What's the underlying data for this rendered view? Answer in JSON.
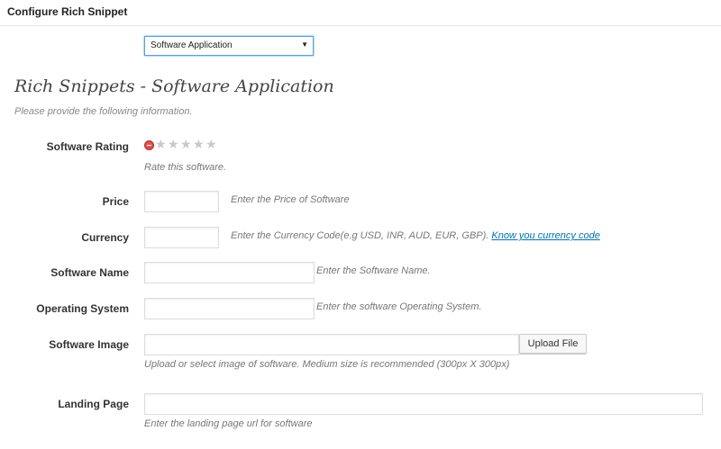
{
  "header": {
    "title": "Configure Rich Snippet"
  },
  "type_select": {
    "value": "Software Application"
  },
  "section": {
    "title": "Rich Snippets - Software Application",
    "subtitle": "Please provide the following information."
  },
  "fields": {
    "rating": {
      "label": "Software Rating",
      "hint": "Rate this software.",
      "stars_total": 5,
      "stars_selected": 0
    },
    "price": {
      "label": "Price",
      "value": "",
      "hint": "Enter the Price of Software"
    },
    "currency": {
      "label": "Currency",
      "value": "",
      "hint": "Enter the Currency Code(e.g USD, INR, AUD, EUR, GBP).",
      "link": "Know you currency code"
    },
    "name": {
      "label": "Software Name",
      "value": "",
      "hint": "Enter the Software Name."
    },
    "os": {
      "label": "Operating System",
      "value": "",
      "hint": "Enter the software Operating System."
    },
    "image": {
      "label": "Software Image",
      "value": "",
      "button": "Upload File",
      "hint": "Upload or select image of software. Medium size is recommended (300px X 300px)"
    },
    "landing": {
      "label": "Landing Page",
      "value": "",
      "hint": "Enter the landing page url for software"
    }
  }
}
